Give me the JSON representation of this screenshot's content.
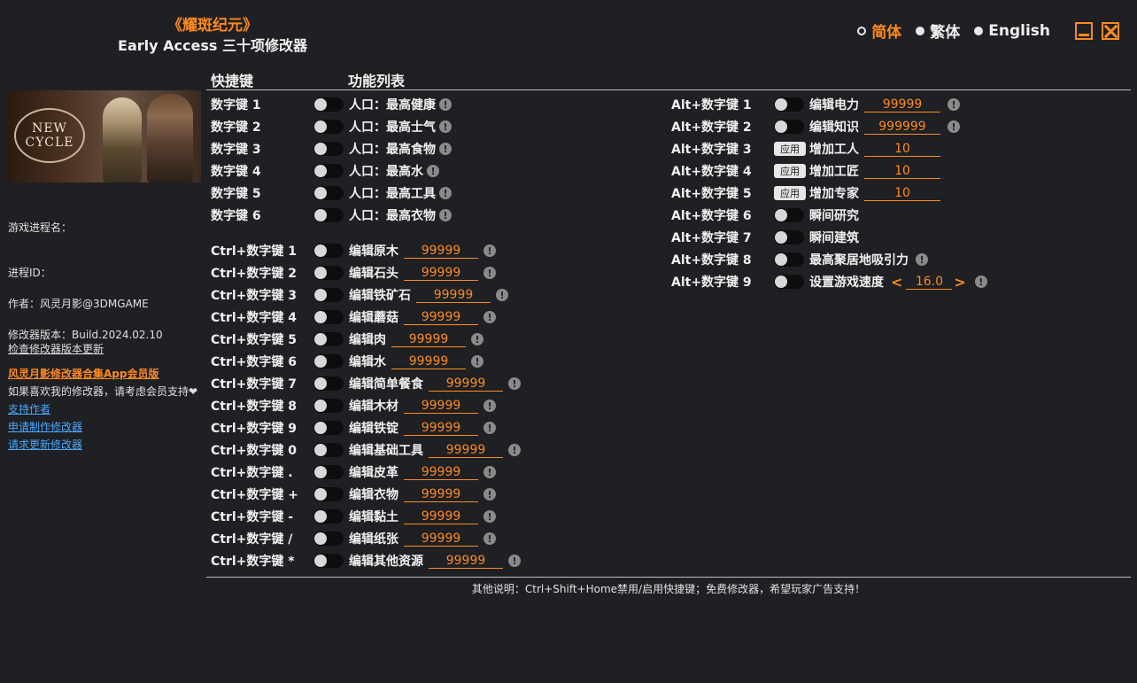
{
  "header": {
    "game_title": "《耀斑纪元》",
    "sub_title": "Early Access 三十项修改器",
    "languages": [
      "简体",
      "繁体",
      "English"
    ]
  },
  "sidebar": {
    "cover_logo_line1": "NEW",
    "cover_logo_line2": "CYCLE",
    "process_name_label": "游戏进程名：",
    "process_id_label": "进程ID：",
    "author": "作者：风灵月影@3DMGAME",
    "version": "修改器版本：Build.2024.02.10",
    "check_update": "检查修改器版本更新",
    "app_promo": "风灵月影修改器合集App会员版",
    "support_text": "如果喜欢我的修改器，请考虑会员支持",
    "links": [
      "支持作者",
      "申请制作修改器",
      "请求更新修改器"
    ]
  },
  "columns": {
    "hotkey": "快捷键",
    "features": "功能列表"
  },
  "left_rows": [
    {
      "key": "数字键 1",
      "label": "人口：最高健康"
    },
    {
      "key": "数字键 2",
      "label": "人口：最高士气"
    },
    {
      "key": "数字键 3",
      "label": "人口：最高食物"
    },
    {
      "key": "数字键 4",
      "label": "人口：最高水"
    },
    {
      "key": "数字键 5",
      "label": "人口：最高工具"
    },
    {
      "key": "数字键 6",
      "label": "人口：最高衣物"
    }
  ],
  "ctrl_rows": [
    {
      "key": "Ctrl+数字键 1",
      "label": "编辑原木",
      "value": "99999"
    },
    {
      "key": "Ctrl+数字键 2",
      "label": "编辑石头",
      "value": "99999"
    },
    {
      "key": "Ctrl+数字键 3",
      "label": "编辑铁矿石",
      "value": "99999"
    },
    {
      "key": "Ctrl+数字键 4",
      "label": "编辑蘑菇",
      "value": "99999"
    },
    {
      "key": "Ctrl+数字键 5",
      "label": "编辑肉",
      "value": "99999"
    },
    {
      "key": "Ctrl+数字键 6",
      "label": "编辑水",
      "value": "99999"
    },
    {
      "key": "Ctrl+数字键 7",
      "label": "编辑简单餐食",
      "value": "99999"
    },
    {
      "key": "Ctrl+数字键 8",
      "label": "编辑木材",
      "value": "99999"
    },
    {
      "key": "Ctrl+数字键 9",
      "label": "编辑铁锭",
      "value": "99999"
    },
    {
      "key": "Ctrl+数字键 0",
      "label": "编辑基础工具",
      "value": "99999"
    },
    {
      "key": "Ctrl+数字键 .",
      "label": "编辑皮革",
      "value": "99999"
    },
    {
      "key": "Ctrl+数字键 +",
      "label": "编辑衣物",
      "value": "99999"
    },
    {
      "key": "Ctrl+数字键 -",
      "label": "编辑黏土",
      "value": "99999"
    },
    {
      "key": "Ctrl+数字键 /",
      "label": "编辑纸张",
      "value": "99999"
    },
    {
      "key": "Ctrl+数字键 *",
      "label": "编辑其他资源",
      "value": "99999"
    }
  ],
  "alt_rows": [
    {
      "key": "Alt+数字键 1",
      "control": "toggle",
      "label": "编辑电力",
      "value": "99999",
      "info": true
    },
    {
      "key": "Alt+数字键 2",
      "control": "toggle",
      "label": "编辑知识",
      "value": "999999",
      "info": true
    },
    {
      "key": "Alt+数字键 3",
      "control": "apply",
      "apply_label": "应用",
      "label": "增加工人",
      "value": "10",
      "info": false
    },
    {
      "key": "Alt+数字键 4",
      "control": "apply",
      "apply_label": "应用",
      "label": "增加工匠",
      "value": "10",
      "info": false
    },
    {
      "key": "Alt+数字键 5",
      "control": "apply",
      "apply_label": "应用",
      "label": "增加专家",
      "value": "10",
      "info": false
    },
    {
      "key": "Alt+数字键 6",
      "control": "toggle",
      "label": "瞬间研究",
      "info": false
    },
    {
      "key": "Alt+数字键 7",
      "control": "toggle",
      "label": "瞬间建筑",
      "info": false
    },
    {
      "key": "Alt+数字键 8",
      "control": "toggle",
      "label": "最高聚居地吸引力",
      "info": true
    },
    {
      "key": "Alt+数字键 9",
      "control": "toggle",
      "label": "设置游戏速度",
      "value": "16.0",
      "stepper": true,
      "info": true
    }
  ],
  "footer": "其他说明：Ctrl+Shift+Home禁用/启用快捷键；免费修改器，希望玩家广告支持！"
}
